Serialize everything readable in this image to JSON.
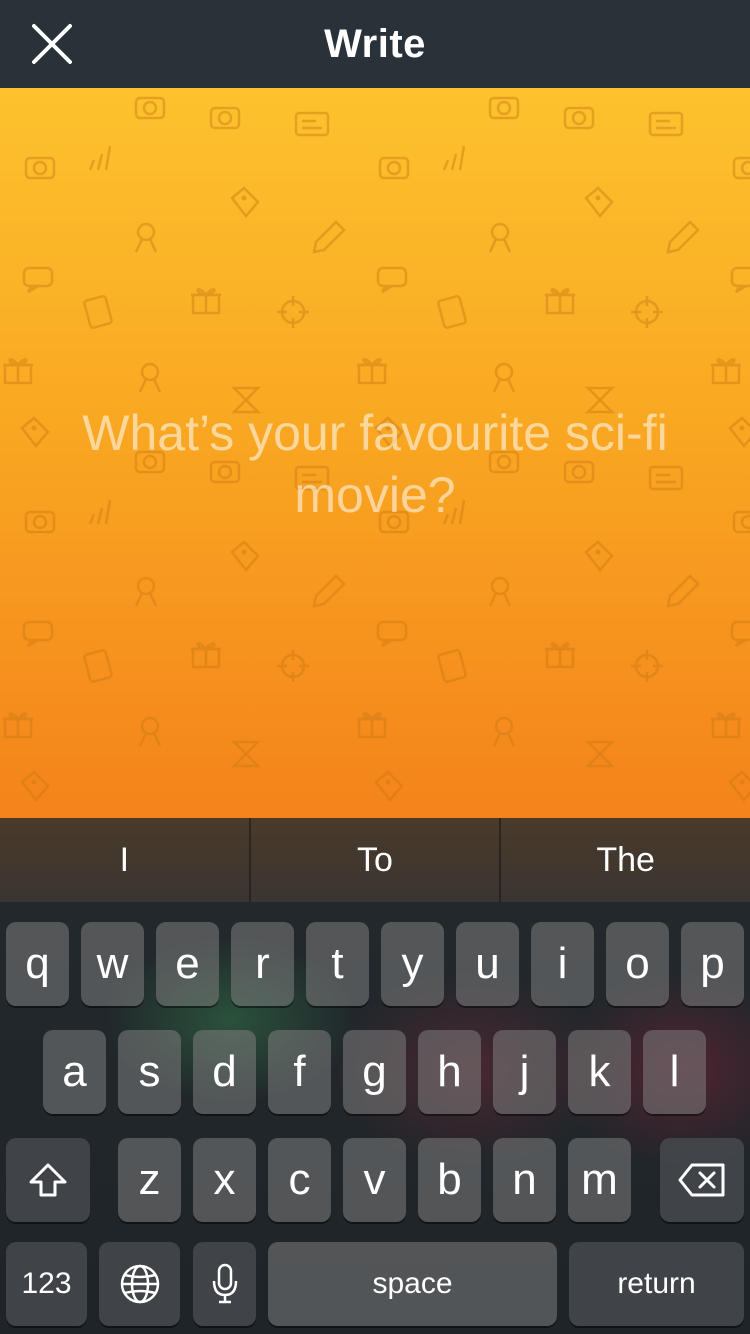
{
  "header": {
    "title": "Write",
    "close_icon": "close-icon"
  },
  "compose": {
    "placeholder": "What’s your favourite sci-fi movie?",
    "gradient_top": "#fdc22e",
    "gradient_bottom": "#f4831b"
  },
  "keyboard": {
    "predictions": [
      "I",
      "To",
      "The"
    ],
    "row1": [
      "q",
      "w",
      "e",
      "r",
      "t",
      "y",
      "u",
      "i",
      "o",
      "p"
    ],
    "row2": [
      "a",
      "s",
      "d",
      "f",
      "g",
      "h",
      "j",
      "k",
      "l"
    ],
    "row3": [
      "z",
      "x",
      "c",
      "v",
      "b",
      "n",
      "m"
    ],
    "numbers_label": "123",
    "space_label": "space",
    "return_label": "return",
    "shift_icon": "shift-icon",
    "delete_icon": "backspace-icon",
    "globe_icon": "globe-icon",
    "mic_icon": "microphone-icon"
  }
}
